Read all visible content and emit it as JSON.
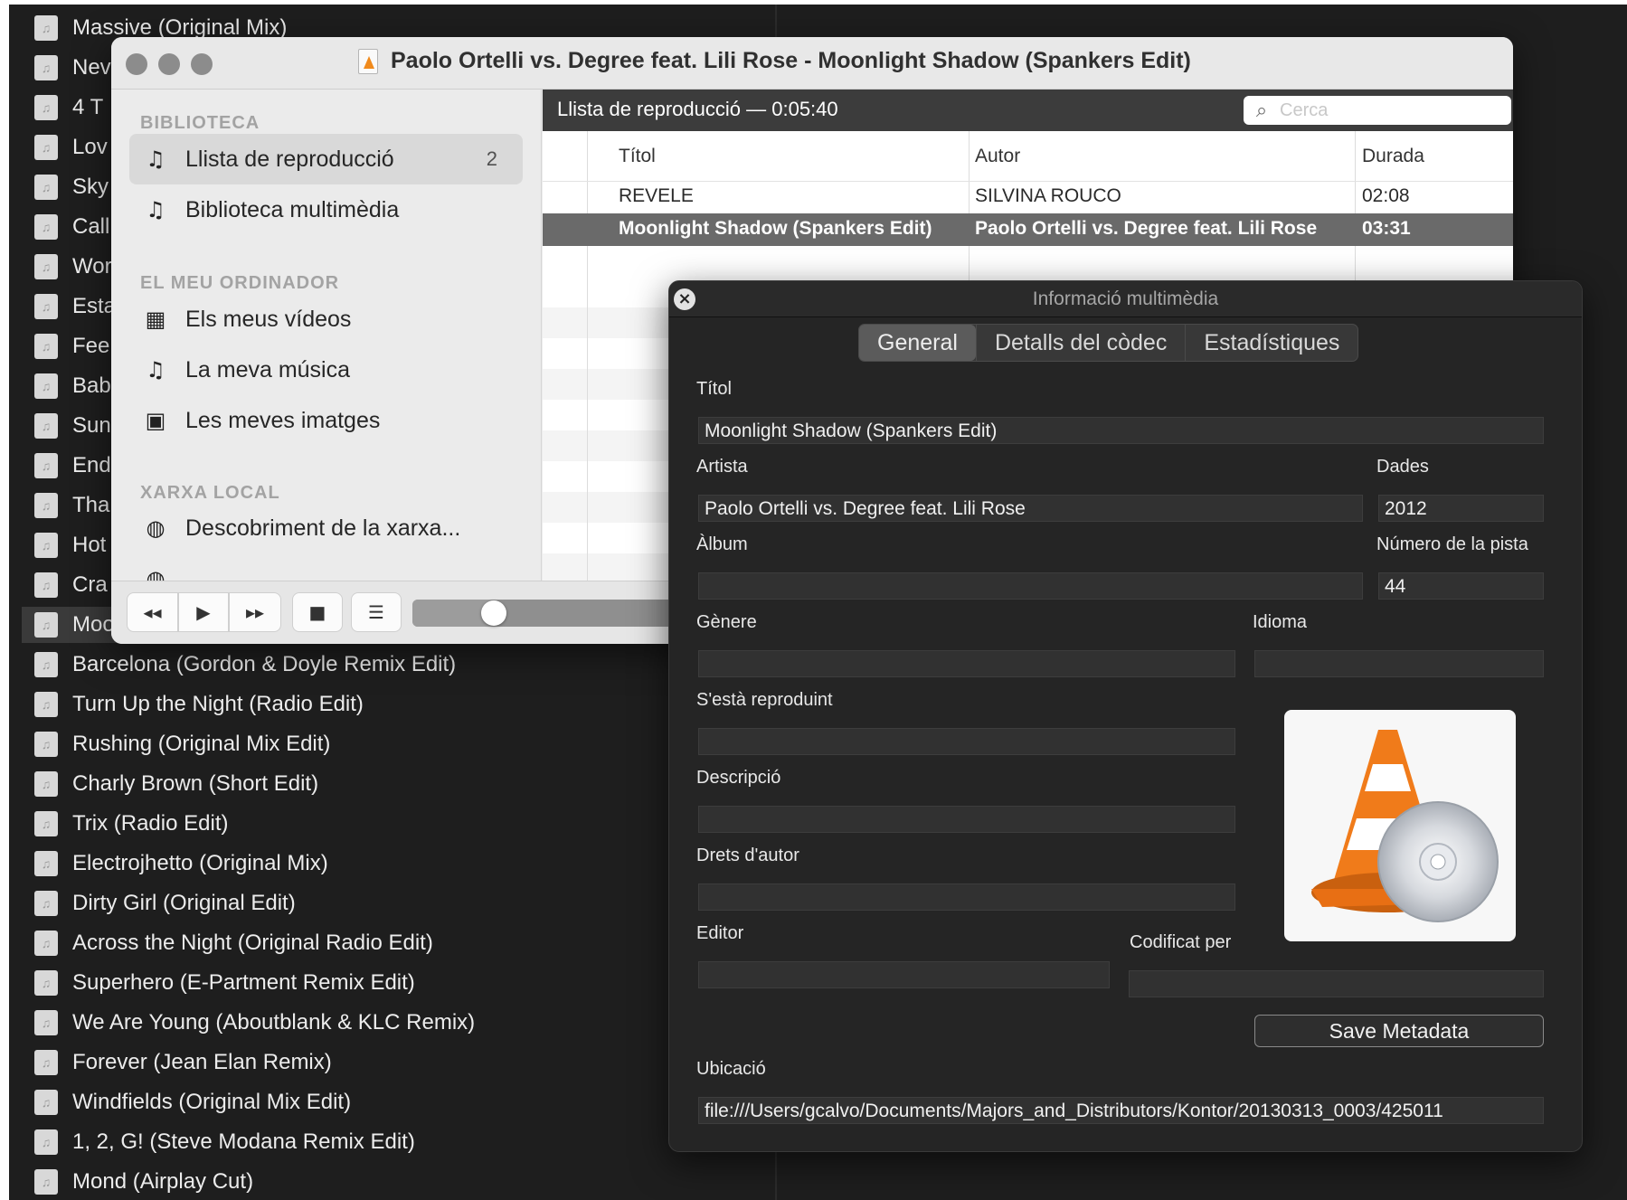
{
  "background_list": {
    "items": [
      "Massive (Original Mix)",
      "Nev",
      "4 T",
      "Lov",
      "Sky",
      "Call",
      "Wor",
      "Esta",
      "Fee",
      "Bab",
      "Sun",
      "End",
      "Tha",
      "Hot",
      "Cra",
      "Moo",
      "Barcelona (Gordon & Doyle Remix Edit)",
      "Turn Up the Night (Radio Edit)",
      "Rushing (Original Mix Edit)",
      "Charly Brown (Short Edit)",
      "Trix (Radio Edit)",
      "Electrojhetto (Original Mix)",
      "Dirty Girl (Original Edit)",
      "Across the Night (Original Radio Edit)",
      "Superhero (E-Partment Remix Edit)",
      "We Are Young (Aboutblank & KLC Remix)",
      "Forever (Jean Elan Remix)",
      "Windfields (Original Mix Edit)",
      "1, 2, G! (Steve Modana Remix Edit)",
      "Mond (Airplay Cut)"
    ],
    "selected_index": 15
  },
  "window": {
    "title": "Paolo Ortelli vs. Degree feat. Lili Rose - Moonlight Shadow (Spankers Edit)"
  },
  "sidebar": {
    "sections": [
      {
        "heading": "BIBLIOTECA",
        "items": [
          {
            "label": "Llista de reproducció",
            "badge": "2",
            "icon": "playlist-icon",
            "glyph": "♫"
          },
          {
            "label": "Biblioteca multimèdia",
            "badge": "",
            "icon": "library-icon",
            "glyph": "♫"
          }
        ]
      },
      {
        "heading": "EL MEU ORDINADOR",
        "items": [
          {
            "label": "Els meus vídeos",
            "icon": "film-icon",
            "glyph": "▦"
          },
          {
            "label": "La meva música",
            "icon": "music-note-icon",
            "glyph": "♫"
          },
          {
            "label": "Les meves imatges",
            "icon": "picture-icon",
            "glyph": "▣"
          }
        ]
      },
      {
        "heading": "XARXA LOCAL",
        "items": [
          {
            "label": "Descobriment de la xarxa...",
            "icon": "network-icon",
            "glyph": "◍"
          }
        ]
      }
    ]
  },
  "playlist": {
    "header": "Llista de reproducció — 0:05:40",
    "search_placeholder": "Cerca",
    "columns": [
      "Títol",
      "Autor",
      "Durada"
    ],
    "rows": [
      {
        "title": "REVELE",
        "author": "SILVINA ROUCO",
        "duration": "02:08",
        "selected": false
      },
      {
        "title": "Moonlight Shadow (Spankers Edit)",
        "author": "Paolo Ortelli vs. Degree feat. Lili Rose",
        "duration": "03:31",
        "selected": true
      }
    ]
  },
  "controls": {
    "buttons": [
      {
        "name": "rewind-button",
        "glyph": "◂◂"
      },
      {
        "name": "play-button",
        "glyph": "▶"
      },
      {
        "name": "fast-forward-button",
        "glyph": "▸▸"
      },
      {
        "name": "stop-button",
        "glyph": "■"
      },
      {
        "name": "playlist-toggle-button",
        "glyph": "☰"
      }
    ],
    "progress_fraction": 0.18
  },
  "info_panel": {
    "title": "Informació multimèdia",
    "tabs": [
      "General",
      "Detalls del còdec",
      "Estadístiques"
    ],
    "active_tab": 0,
    "fields": {
      "title_label": "Títol",
      "title_value": "Moonlight Shadow (Spankers Edit)",
      "artist_label": "Artista",
      "artist_value": "Paolo Ortelli vs. Degree feat. Lili Rose",
      "date_label": "Dades",
      "date_value": "2012",
      "album_label": "Àlbum",
      "album_value": "",
      "track_label": "Número de la pista",
      "track_value": "44",
      "genre_label": "Gènere",
      "genre_value": "",
      "language_label": "Idioma",
      "language_value": "",
      "now_playing_label": "S'està reproduint",
      "now_playing_value": "",
      "description_label": "Descripció",
      "description_value": "",
      "copyright_label": "Drets d'autor",
      "copyright_value": "",
      "publisher_label": "Editor",
      "publisher_value": "",
      "encoded_by_label": "Codificat per",
      "encoded_by_value": "",
      "location_label": "Ubicació",
      "location_value": "file:///Users/gcalvo/Documents/Majors_and_Distributors/Kontor/20130313_0003/425011"
    },
    "save_label": "Save Metadata",
    "artwork_icon": "vlc-cone-icon"
  },
  "colors": {
    "accent_cone": "#f07b1a",
    "selected_row": "#6a6a6a",
    "panel_bg": "#252525"
  }
}
